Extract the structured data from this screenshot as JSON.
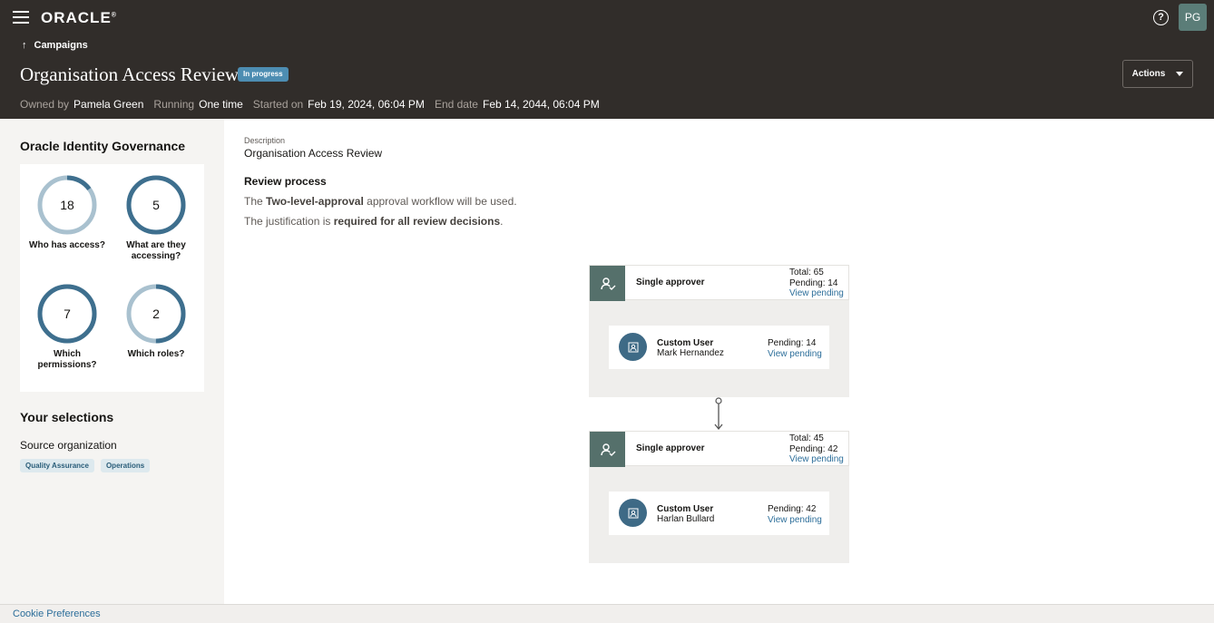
{
  "header": {
    "logo": "ORACLE",
    "logo_suffix": "®",
    "avatar_initials": "PG",
    "breadcrumb": "Campaigns",
    "title": "Organisation Access Review",
    "status": "In progress",
    "actions_label": "Actions",
    "meta": {
      "owned_by_label": "Owned by",
      "owned_by": "Pamela Green",
      "running_label": "Running",
      "running": "One time",
      "started_label": "Started on",
      "started": "Feb 19, 2024, 06:04 PM",
      "end_label": "End date",
      "end": "Feb 14, 2044, 06:04 PM"
    }
  },
  "sidebar": {
    "title": "Oracle Identity Governance",
    "metrics": [
      {
        "value": "18",
        "label": "Who has access?",
        "fraction": 0.15
      },
      {
        "value": "5",
        "label": "What are they accessing?",
        "fraction": 1.0
      },
      {
        "value": "7",
        "label": "Which permissions?",
        "fraction": 1.0
      },
      {
        "value": "2",
        "label": "Which roles?",
        "fraction": 0.5
      }
    ],
    "selections_title": "Your selections",
    "source_label": "Source organization",
    "chips": [
      "Quality Assurance",
      "Operations"
    ]
  },
  "main": {
    "description_label": "Description",
    "description": "Organisation Access Review",
    "process_title": "Review process",
    "line1_a": "The ",
    "line1_b": "Two-level-approval",
    "line1_c": " approval workflow will be used.",
    "line2_a": "The justification is ",
    "line2_b": "required for all review decisions",
    "line2_c": "."
  },
  "workflow": [
    {
      "name": "Single approver",
      "total": "Total: 65",
      "pending": "Pending: 14",
      "link": "View pending",
      "user_role": "Custom User",
      "user_name": "Mark Hernandez",
      "user_pending": "Pending: 14",
      "user_link": "View pending"
    },
    {
      "name": "Single approver",
      "total": "Total: 45",
      "pending": "Pending: 42",
      "link": "View pending",
      "user_role": "Custom User",
      "user_name": "Harlan Bullard",
      "user_pending": "Pending: 42",
      "user_link": "View pending"
    }
  ],
  "footer": {
    "cookie": "Cookie Preferences"
  },
  "colors": {
    "header_bg": "#312d2a",
    "badge": "#4d8db2",
    "ring": "#3e6f8e",
    "ring_track": "#a9c1cf",
    "link": "#2c6e9a"
  }
}
